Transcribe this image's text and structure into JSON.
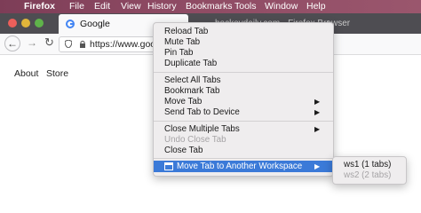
{
  "os_menubar": {
    "app_name": "Firefox",
    "items": [
      "File",
      "Edit",
      "View",
      "History",
      "Bookmarks",
      "Tools",
      "Window",
      "Help"
    ]
  },
  "tabs": [
    {
      "title": "Google",
      "active": true
    },
    {
      "title": "…hockeydaily.com - Firefox Browser",
      "active": false
    }
  ],
  "toolbar": {
    "url": "https://www.goo"
  },
  "page": {
    "links": [
      "About",
      "Store"
    ]
  },
  "context_menu": {
    "groups": [
      [
        {
          "label": "Reload Tab"
        },
        {
          "label": "Mute Tab"
        },
        {
          "label": "Pin Tab"
        },
        {
          "label": "Duplicate Tab"
        }
      ],
      [
        {
          "label": "Select All Tabs"
        },
        {
          "label": "Bookmark Tab"
        },
        {
          "label": "Move Tab",
          "submenu": true
        },
        {
          "label": "Send Tab to Device",
          "submenu": true
        }
      ],
      [
        {
          "label": "Close Multiple Tabs",
          "submenu": true
        },
        {
          "label": "Undo Close Tab",
          "disabled": true
        },
        {
          "label": "Close Tab"
        }
      ],
      [
        {
          "label": "Move Tab to Another Workspace",
          "submenu": true,
          "highlighted": true,
          "icon": "workspace-icon"
        }
      ]
    ]
  },
  "submenu": {
    "items": [
      {
        "label": "ws1 (1 tabs)",
        "disabled": false
      },
      {
        "label": "ws2 (2 tabs)",
        "disabled": true
      }
    ]
  },
  "colors": {
    "menubar": "#8e4a63",
    "highlight": "#3b7ad8",
    "disabled_text": "#a6a4a6"
  }
}
